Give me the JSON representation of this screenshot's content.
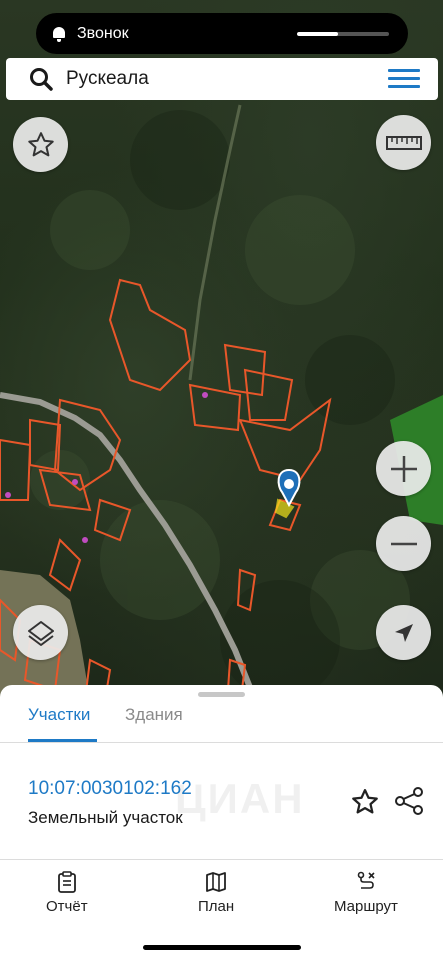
{
  "status_bar": {
    "call_label": "Звонок",
    "call_progress": 0.45
  },
  "search": {
    "query": "Рускеала"
  },
  "bottom_sheet": {
    "tabs": [
      {
        "label": "Участки",
        "active": true
      },
      {
        "label": "Здания",
        "active": false
      }
    ],
    "parcel": {
      "cadastral_number": "10:07:0030102:162",
      "type": "Земельный участок"
    }
  },
  "nav": {
    "items": [
      {
        "label": "Отчёт",
        "icon": "clipboard-icon"
      },
      {
        "label": "План",
        "icon": "map-icon"
      },
      {
        "label": "Маршрут",
        "icon": "route-icon"
      }
    ]
  },
  "colors": {
    "accent": "#1e7ac6",
    "parcel_outline": "#e8572a",
    "selected_parcel": "#f2e31b",
    "pin": "#1e6fb8"
  }
}
